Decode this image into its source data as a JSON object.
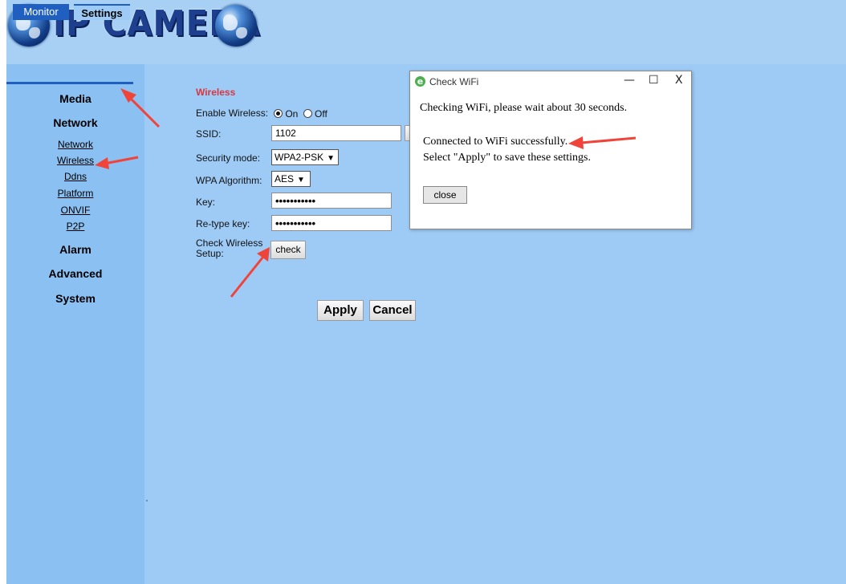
{
  "logo": {
    "text": "IP CAMERA"
  },
  "tabs": {
    "monitor": "Monitor",
    "settings": "Settings"
  },
  "sidebar": {
    "media": "Media",
    "network": "Network",
    "network_links": [
      "Network",
      "Wireless",
      "Ddns",
      "Platform",
      "ONVIF",
      "P2P"
    ],
    "alarm": "Alarm",
    "advanced": "Advanced",
    "system": "System"
  },
  "form": {
    "title": "Wireless",
    "enable_label": "Enable Wireless:",
    "on_label": "On",
    "off_label": "Off",
    "enable_value": "On",
    "ssid_label": "SSID:",
    "ssid_value": "1102",
    "security_label": "Security mode:",
    "security_value": "WPA2-PSK",
    "wpa_label": "WPA Algorithm:",
    "wpa_value": "AES",
    "key_label": "Key:",
    "key_value": "•••••••••••",
    "retype_label": "Re-type key:",
    "retype_value": "•••••••••••",
    "check_label_1": "Check Wireless",
    "check_label_2": "Setup:",
    "check_button": "check",
    "apply_button": "Apply",
    "cancel_button": "Cancel"
  },
  "dialog": {
    "title": "Check WiFi",
    "line1": "Checking WiFi, please wait about 30 seconds.",
    "line2": "Connected to WiFi successfully.",
    "line3": "Select \"Apply\" to save these settings.",
    "close_button": "close",
    "minimize": "—",
    "maximize": "☐",
    "close_x": "X"
  },
  "colors": {
    "page_bg": "#9ecbf6",
    "sidebar_bg": "#8bc0f2",
    "tab_active": "#1f5fbf",
    "title_red": "#d9363e",
    "annotation_arrow": "#f0443a"
  }
}
